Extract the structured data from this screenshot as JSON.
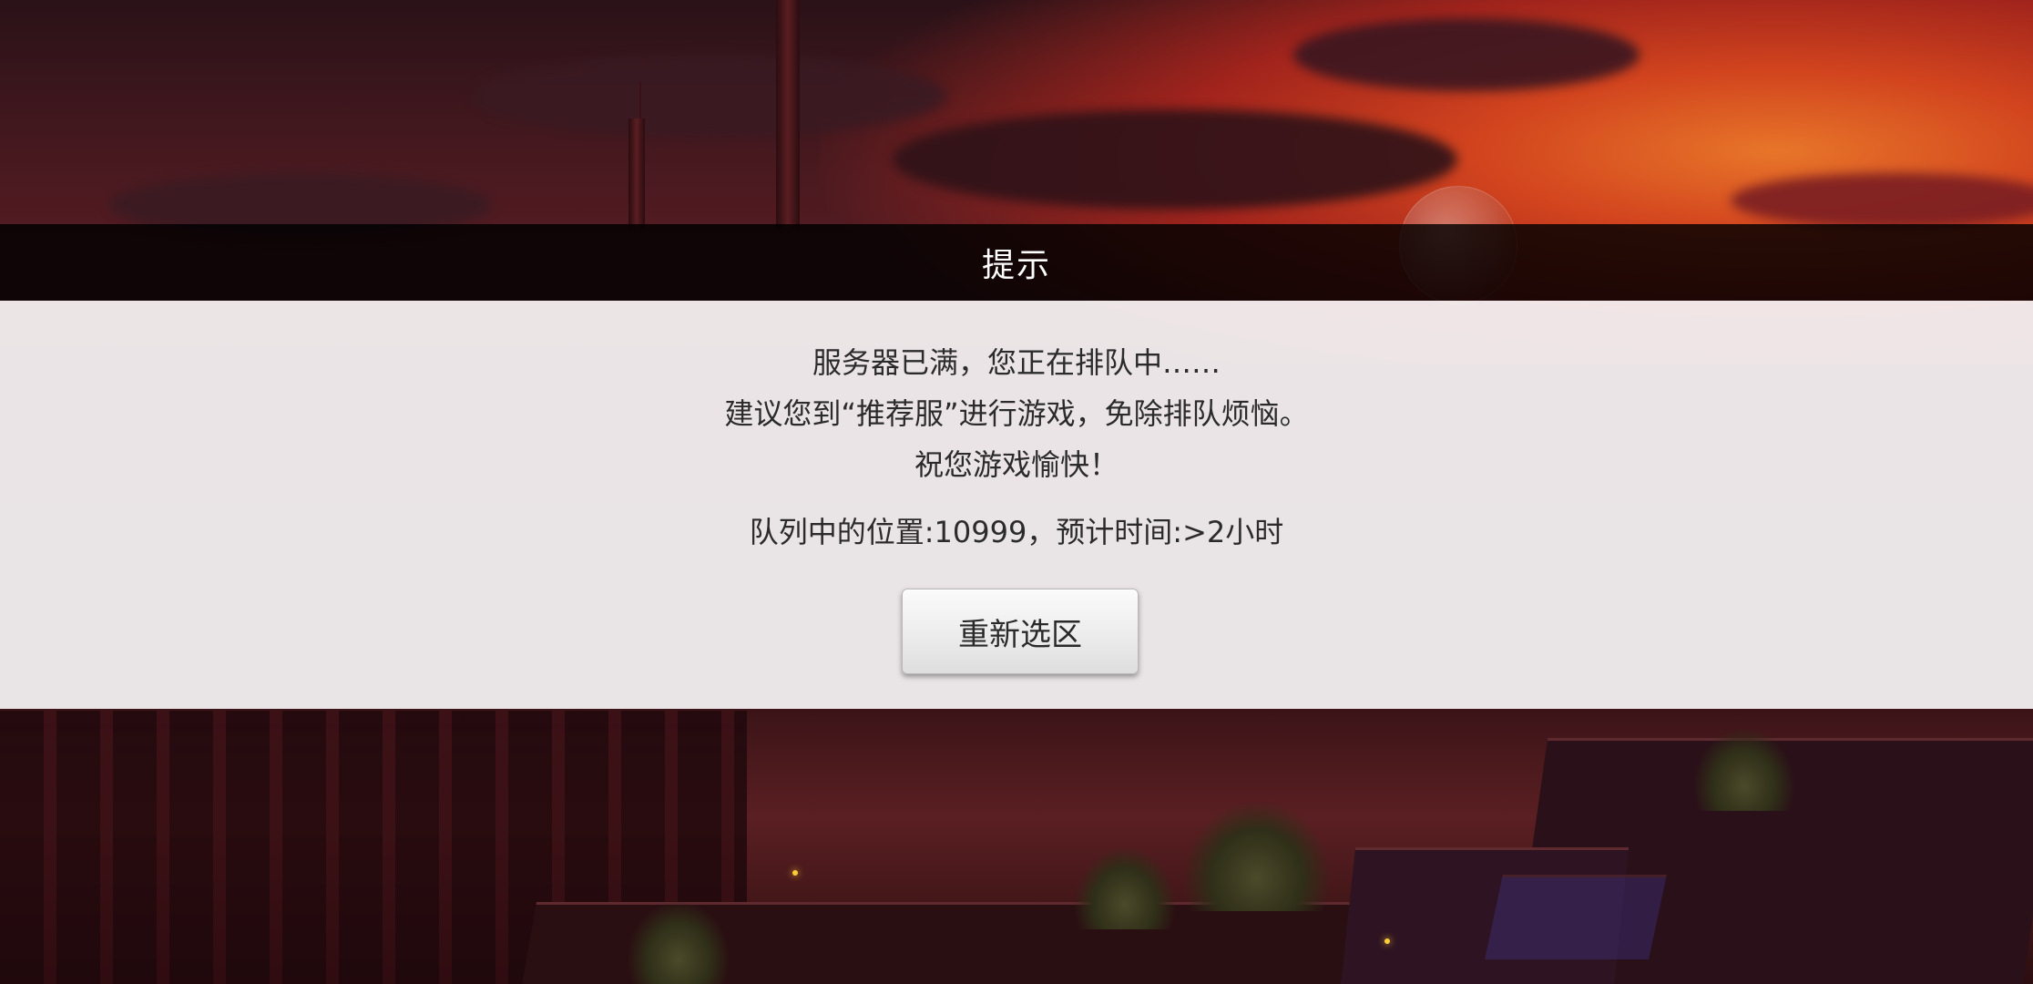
{
  "dialog": {
    "title": "提示",
    "message_lines": [
      "服务器已满，您正在排队中……",
      "建议您到“推荐服”进行游戏，免除排队烦恼。",
      "祝您游戏愉快！"
    ],
    "queue_info": "队列中的位置:10999，预计时间:>2小时",
    "reselect_button_label": "重新选区"
  },
  "colors": {
    "title_bar": "#000000",
    "panel": "#f6f4f5",
    "text": "#2b2b2b",
    "sky_accent": "#d9461e"
  }
}
